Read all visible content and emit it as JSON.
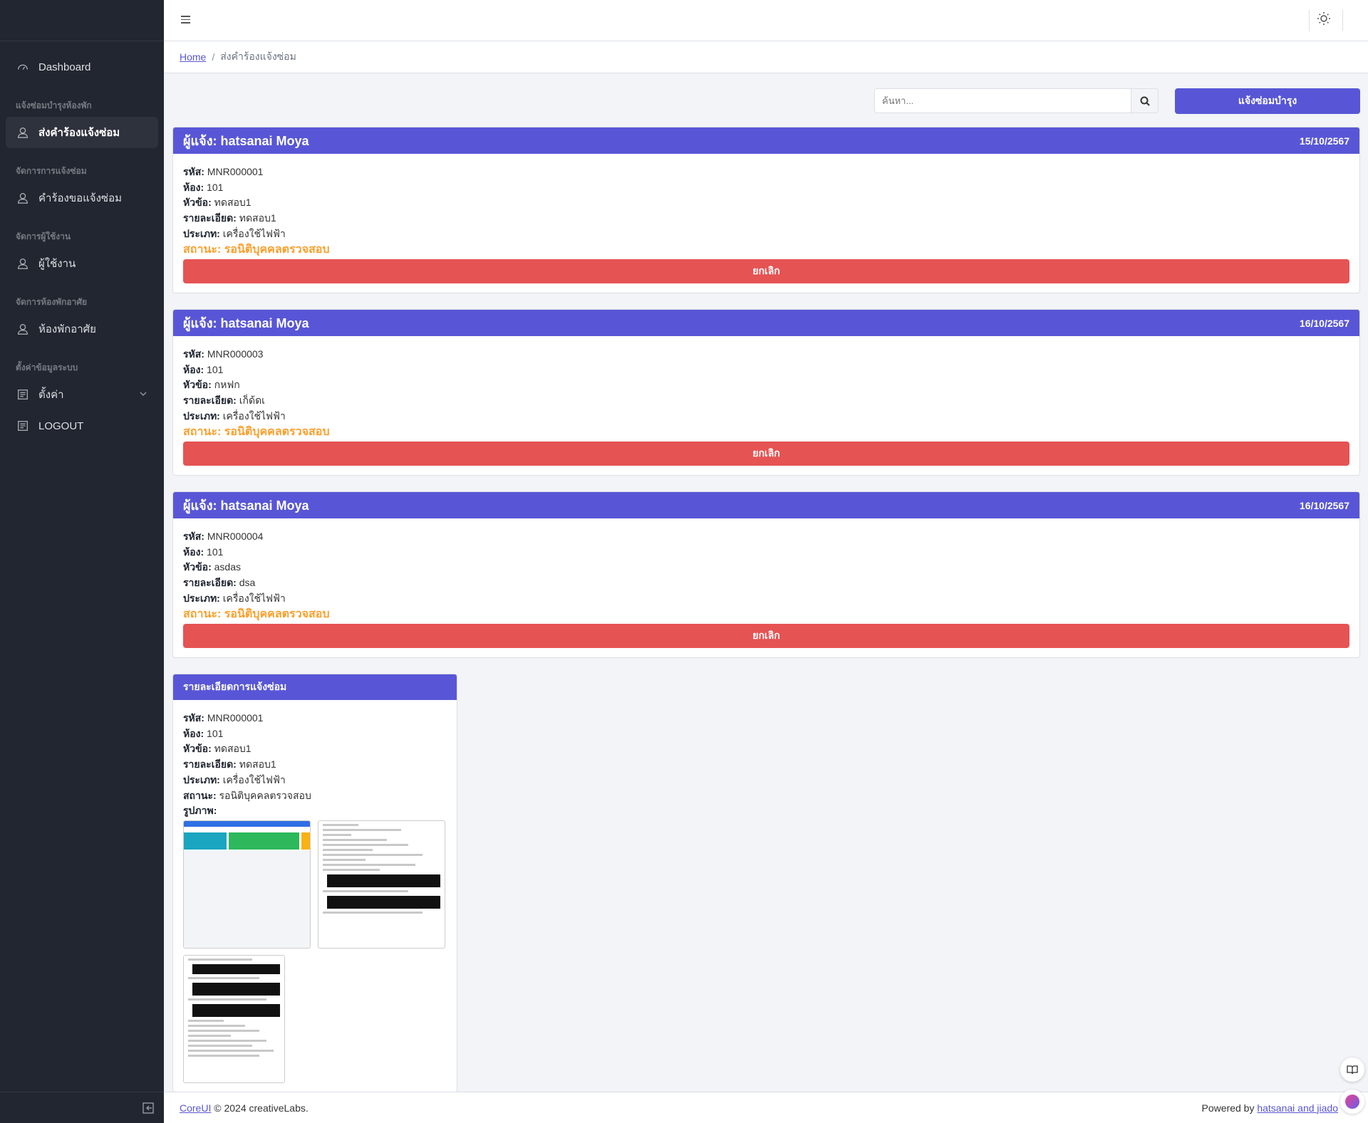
{
  "sidebar": {
    "dashboard": "Dashboard",
    "section1": "แจ้งซ่อมบำรุงห้องพัก",
    "item_submit": "ส่งคำร้องแจ้งซ่อม",
    "section2": "จัดการการแจ้งซ่อม",
    "item_requests": "คำร้องขอแจ้งซ่อม",
    "section3": "จัดการผู้ใช้งาน",
    "item_users": "ผู้ใช้งาน",
    "section4": "จัดการห้องพักอาศัย",
    "item_rooms": "ห้องพักอาศัย",
    "section5": "ตั้งค่าข้อมูลระบบ",
    "item_settings": "ตั้งค่า",
    "item_logout": "LOGOUT"
  },
  "breadcrumb": {
    "home": "Home",
    "separator": "/",
    "current": "ส่งคำร้องแจ้งซ่อม"
  },
  "toolbar": {
    "search_placeholder": "ค้นหา...",
    "report_button": "แจ้งซ่อมบำรุง"
  },
  "labels": {
    "reporter": "ผู้แจ้ง:",
    "code": "รหัส:",
    "room": "ห้อง:",
    "topic": "หัวข้อ:",
    "detail": "รายละเอียด:",
    "type": "ประเภท:",
    "status": "สถานะ:",
    "images": "รูปภาพ:",
    "cancel": "ยกเลิก"
  },
  "requests": [
    {
      "reporter": "hatsanai Moya",
      "date": "15/10/2567",
      "code": "MNR000001",
      "room": "101",
      "topic": "ทดสอบ1",
      "detail": "ทดสอบ1",
      "type": "เครื่องใช้ไฟฟ้า",
      "status": "รอนิติบุคคลตรวจสอบ"
    },
    {
      "reporter": "hatsanai Moya",
      "date": "16/10/2567",
      "code": "MNR000003",
      "room": "101",
      "topic": "กหฟก",
      "detail": "เก็ด้ดเ",
      "type": "เครื่องใช้ไฟฟ้า",
      "status": "รอนิติบุคคลตรวจสอบ"
    },
    {
      "reporter": "hatsanai Moya",
      "date": "16/10/2567",
      "code": "MNR000004",
      "room": "101",
      "topic": "asdas",
      "detail": "dsa",
      "type": "เครื่องใช้ไฟฟ้า",
      "status": "รอนิติบุคคลตรวจสอบ"
    }
  ],
  "detail": {
    "title": "รายละเอียดการแจ้งซ่อม",
    "code": "MNR000001",
    "room": "101",
    "topic": "ทดสอบ1",
    "detail": "ทดสอบ1",
    "type": "เครื่องใช้ไฟฟ้า",
    "status": "รอนิติบุคคลตรวจสอบ"
  },
  "footer": {
    "brand_link": "CoreUI",
    "copyright": "© 2024 creativeLabs.",
    "powered_by": "Powered by",
    "author_link": "hatsanai and jiado"
  },
  "colors": {
    "primary": "#5856d6",
    "danger": "#e55353",
    "warning": "#f9a02d",
    "sidebar": "#212631"
  }
}
